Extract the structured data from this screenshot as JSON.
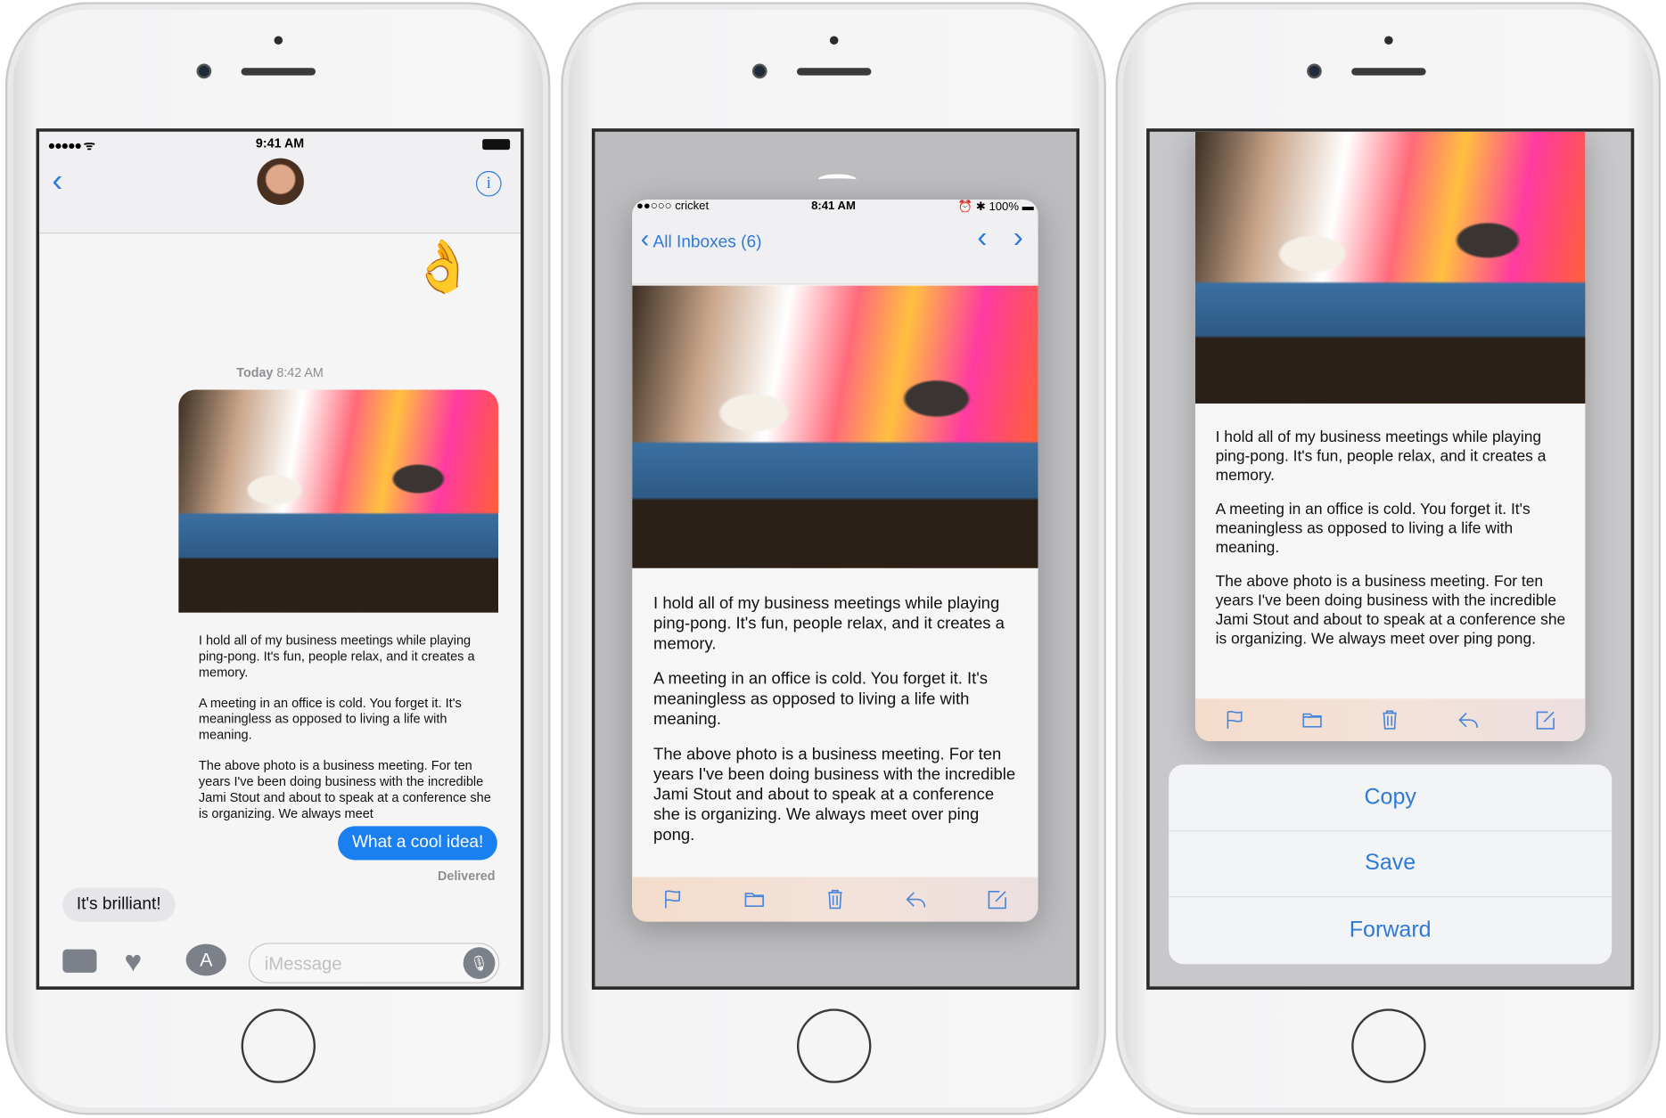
{
  "messages": {
    "status": {
      "time": "9:41 AM"
    },
    "timestamp_day": "Today",
    "timestamp_time": "8:42 AM",
    "sent_reply": "What a cool idea!",
    "delivered": "Delivered",
    "received": "It's brilliant!",
    "input_placeholder": "iMessage",
    "accent": "#1a7ff0"
  },
  "email": {
    "paragraphs": [
      "I hold all of my business meetings while playing ping-pong. It's fun, people relax, and it creates a memory.",
      "A meeting in an office is cold. You forget it. It's meaningless as opposed to living a life with meaning.",
      "The above photo is a business meeting. For ten years I've been doing business with the incredible Jami Stout and about to speak at a conference she is organizing. We always meet over ping pong."
    ],
    "truncated_last_paragraph": "The above photo is a business meeting. For ten years I've been doing business with the incredible Jami Stout and about to speak at a conference she is organizing. We always meet"
  },
  "mail": {
    "status": {
      "carrier": "cricket",
      "time": "8:41 AM",
      "battery": "100%"
    },
    "back_label": "All Inboxes (6)",
    "toolbar_icons": [
      "flag-icon",
      "folder-icon",
      "trash-icon",
      "reply-icon",
      "compose-icon"
    ]
  },
  "actions": [
    "Copy",
    "Save",
    "Forward"
  ]
}
